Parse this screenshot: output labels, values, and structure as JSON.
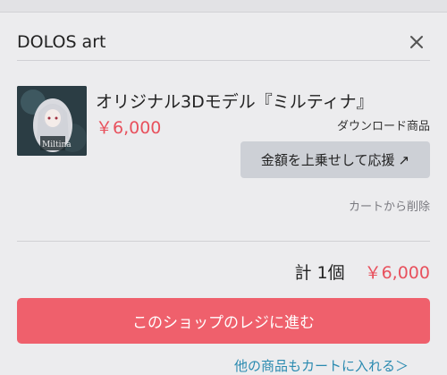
{
  "shop": {
    "name": "DOLOS art"
  },
  "item": {
    "title": "オリジナル3Dモデル『ミルティナ』",
    "price": "￥6,000",
    "type": "ダウンロード商品",
    "tip_button": "金額を上乗せして応援",
    "tip_icon": "↗",
    "remove": "カートから削除",
    "thumb_text": "Miltina"
  },
  "summary": {
    "total_label": "計 1個",
    "total_price": "￥6,000"
  },
  "checkout": {
    "label": "このショップのレジに進む"
  },
  "footer": {
    "link": "他の商品もカートに入れる＞"
  },
  "colors": {
    "accent": "#ef606c",
    "price": "#e8515d",
    "background": "#ececee",
    "link": "#2a8ab0"
  }
}
